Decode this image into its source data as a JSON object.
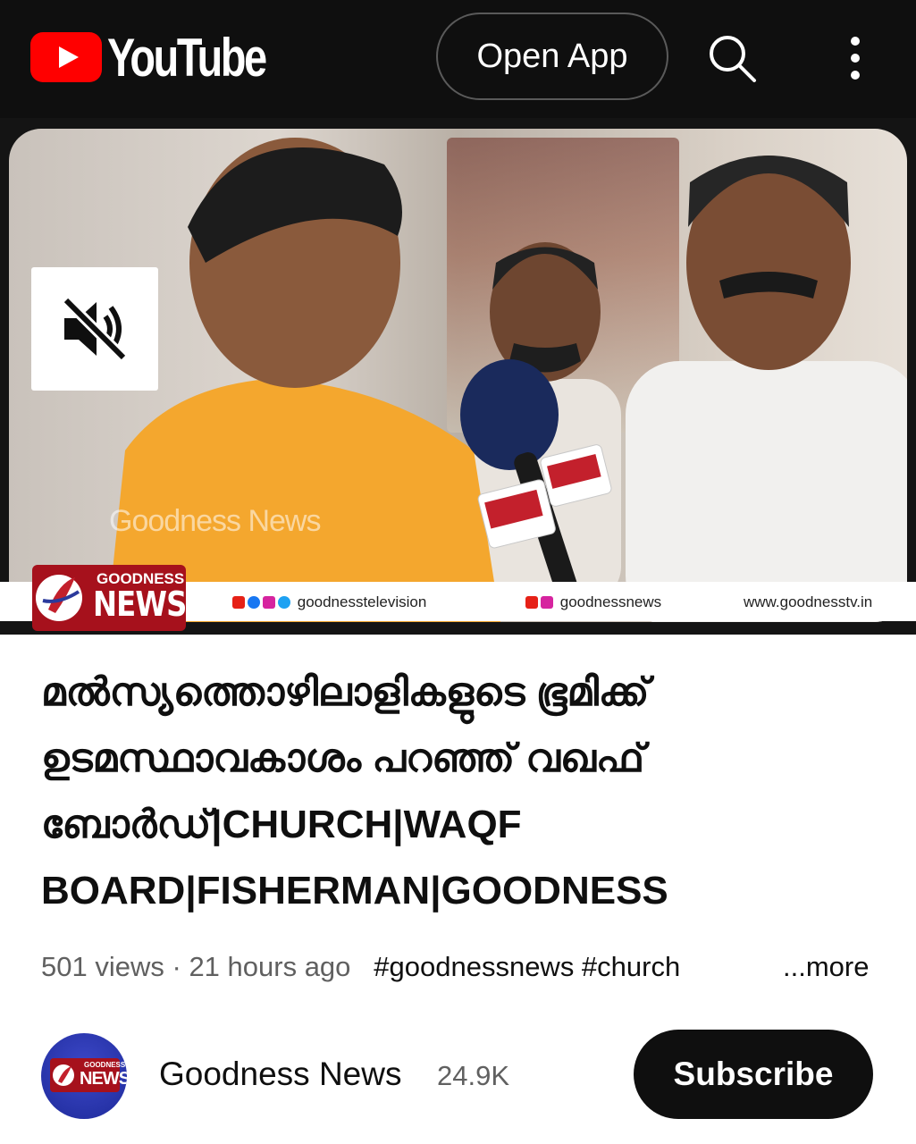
{
  "header": {
    "logo_text": "YouTube",
    "open_app_label": "Open App"
  },
  "video": {
    "watermark": "Goodness News",
    "lower_third": {
      "brand_top": "GOODNESS",
      "brand_bottom": "NEWS",
      "handle_1": "goodnesstelevision",
      "handle_2": "goodnessnews",
      "website": "www.goodnesstv.in"
    },
    "muted": true
  },
  "title": "മൽസ്യത്തൊഴിലാളികളുടെ ഭൂമിക്ക് ഉടമസ്ഥാവകാശം പറഞ്ഞ് വഖഫ് ബോർഡ്|CHURCH|WAQF BOARD|FISHERMAN|GOODNESS",
  "meta": {
    "views": "501 views",
    "separator": "·",
    "age": "21 hours ago",
    "tags": "#goodnessnews #church",
    "more_label": "...more"
  },
  "channel": {
    "name": "Goodness News",
    "subscribers": "24.9K",
    "subscribe_label": "Subscribe"
  },
  "colors": {
    "youtube_red": "#ff0000",
    "topbar": "#0f0f0f",
    "brand_red": "#a6111c"
  }
}
